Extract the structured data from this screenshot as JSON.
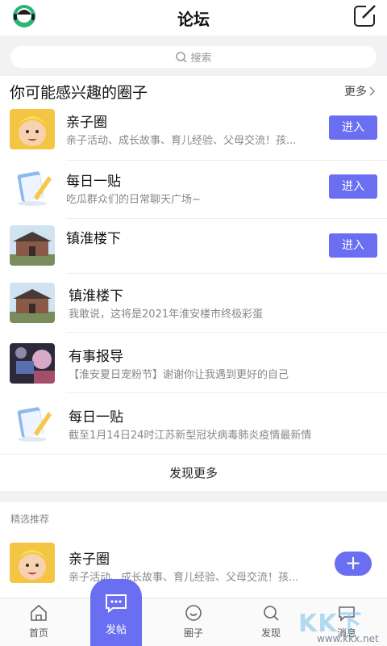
{
  "header": {
    "title": "论坛",
    "logo_icon": "headset-avatar-icon",
    "edit_icon": "edit-icon"
  },
  "search": {
    "placeholder": "搜索"
  },
  "section": {
    "title": "你可能感兴趣的圈子",
    "more": "更多"
  },
  "circles": [
    {
      "name": "亲子圈",
      "desc": "亲子活动、成长故事、育儿经验、父母交流！孩...",
      "button": "进入",
      "thumb": "baby-photo"
    },
    {
      "name": "每日一贴",
      "desc": "吃瓜群众们的日常聊天广场~",
      "button": "进入",
      "thumb": "paper-pen-illustration"
    },
    {
      "name": "镇淮楼下",
      "desc": "",
      "button": "进入",
      "thumb": "tower-photo"
    },
    {
      "name": "镇淮楼下",
      "desc": "我敢说，这将是2021年淮安楼市终极彩蛋",
      "thumb": "tower-photo"
    },
    {
      "name": "有事报导",
      "desc": "【淮安夏日宠粉节】谢谢你让我遇到更好的自己",
      "thumb": "crowd-photo"
    },
    {
      "name": "每日一贴",
      "desc": "截至1月14日24时江苏新型冠状病毒肺炎疫情最新情",
      "thumb": "paper-pen-illustration"
    }
  ],
  "discover_more": "发现更多",
  "featured": {
    "label": "精选推荐",
    "item": {
      "name": "亲子圈",
      "desc": "亲子活动、成长故事、育儿经验、父母交流！孩...",
      "thumb": "baby-photo"
    },
    "fab": "+"
  },
  "tabs": [
    {
      "label": "首页",
      "icon": "home-icon"
    },
    {
      "label": "发帖",
      "icon": "chat-bubble-icon"
    },
    {
      "label": "圈子",
      "icon": "circle-icon"
    },
    {
      "label": "发现",
      "icon": "search-icon"
    },
    {
      "label": "消息",
      "icon": "message-icon"
    }
  ],
  "watermark": {
    "text": "KK下载",
    "url": "www.kkx.net"
  },
  "colors": {
    "accent": "#6a6ff2",
    "background": "#f2f2f4"
  }
}
